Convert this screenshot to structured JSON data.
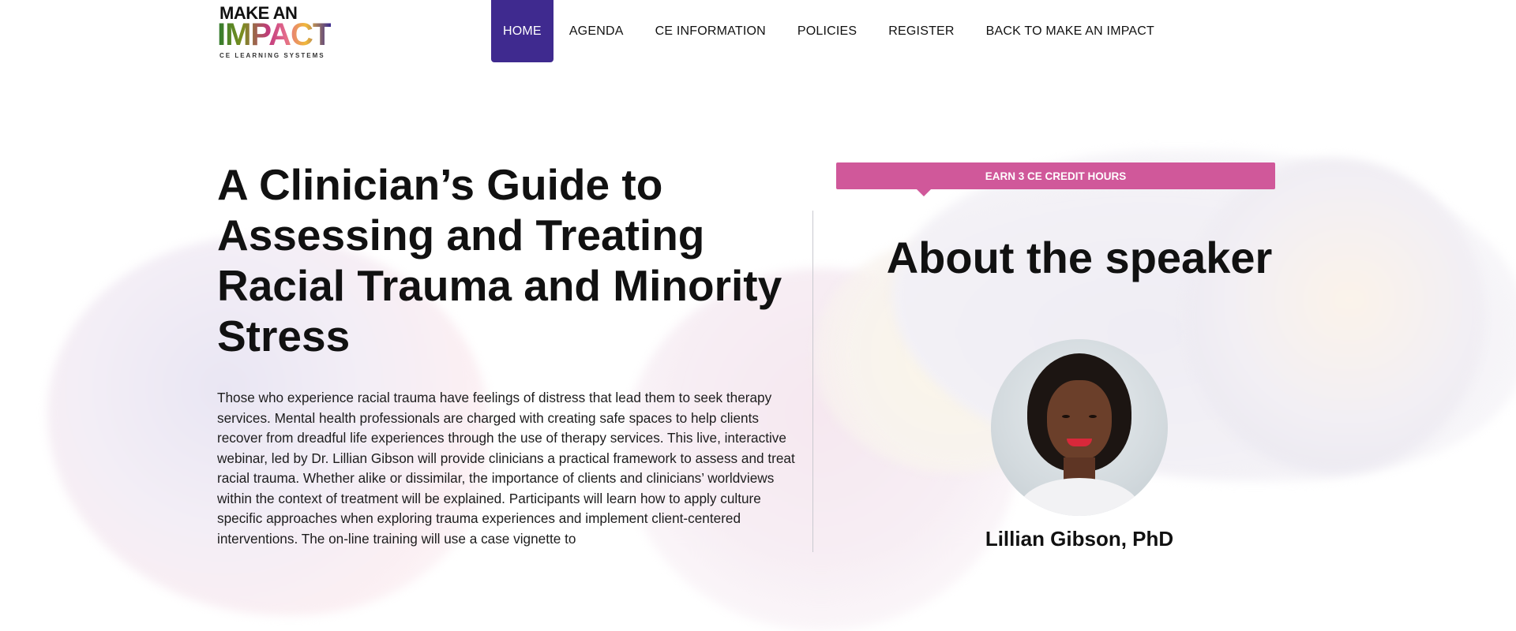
{
  "logo": {
    "line1": "MAKE AN",
    "line2": "IMPACT",
    "line3": "CE LEARNING SYSTEMS"
  },
  "nav": [
    {
      "label": "HOME",
      "active": true
    },
    {
      "label": "AGENDA"
    },
    {
      "label": "CE INFORMATION"
    },
    {
      "label": "POLICIES"
    },
    {
      "label": "REGISTER"
    },
    {
      "label": "BACK TO MAKE AN IMPACT"
    }
  ],
  "main": {
    "title": "A Clinician’s Guide to Assessing and Treating Racial Trauma and Minority Stress",
    "description": "Those who experience racial trauma have feelings of distress that lead them to seek therapy services. Mental health professionals are charged with creating safe spaces to help clients recover from dreadful life experiences through the use of therapy services. This live, interactive webinar, led by Dr. Lillian Gibson will provide clinicians a practical framework to assess and treat racial trauma. Whether alike or dissimilar, the importance of clients and clinicians’ worldviews within the context of treatment will be explained. Participants will learn how to apply culture specific approaches when exploring trauma experiences and implement client-centered interventions. The on-line training will use a case vignette to"
  },
  "sidebar": {
    "banner": "EARN 3 CE CREDIT HOURS",
    "heading": "About the speaker",
    "speaker_name": "Lillian Gibson, PhD"
  },
  "colors": {
    "nav_active": "#3f2a8f",
    "banner": "#d0589a"
  }
}
